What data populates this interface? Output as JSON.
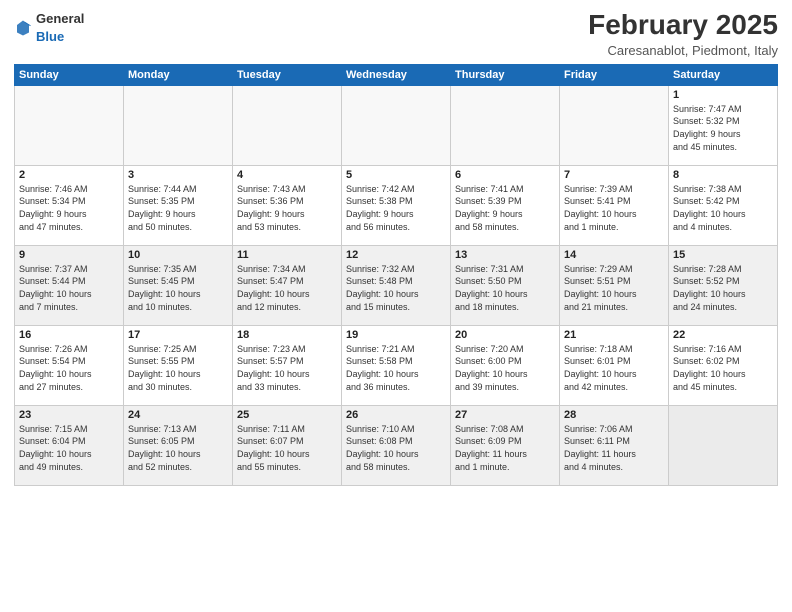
{
  "header": {
    "logo_general": "General",
    "logo_blue": "Blue",
    "month_title": "February 2025",
    "location": "Caresanablot, Piedmont, Italy"
  },
  "days_of_week": [
    "Sunday",
    "Monday",
    "Tuesday",
    "Wednesday",
    "Thursday",
    "Friday",
    "Saturday"
  ],
  "weeks": [
    {
      "shaded": false,
      "days": [
        {
          "num": "",
          "info": ""
        },
        {
          "num": "",
          "info": ""
        },
        {
          "num": "",
          "info": ""
        },
        {
          "num": "",
          "info": ""
        },
        {
          "num": "",
          "info": ""
        },
        {
          "num": "",
          "info": ""
        },
        {
          "num": "1",
          "info": "Sunrise: 7:47 AM\nSunset: 5:32 PM\nDaylight: 9 hours\nand 45 minutes."
        }
      ]
    },
    {
      "shaded": false,
      "days": [
        {
          "num": "2",
          "info": "Sunrise: 7:46 AM\nSunset: 5:34 PM\nDaylight: 9 hours\nand 47 minutes."
        },
        {
          "num": "3",
          "info": "Sunrise: 7:44 AM\nSunset: 5:35 PM\nDaylight: 9 hours\nand 50 minutes."
        },
        {
          "num": "4",
          "info": "Sunrise: 7:43 AM\nSunset: 5:36 PM\nDaylight: 9 hours\nand 53 minutes."
        },
        {
          "num": "5",
          "info": "Sunrise: 7:42 AM\nSunset: 5:38 PM\nDaylight: 9 hours\nand 56 minutes."
        },
        {
          "num": "6",
          "info": "Sunrise: 7:41 AM\nSunset: 5:39 PM\nDaylight: 9 hours\nand 58 minutes."
        },
        {
          "num": "7",
          "info": "Sunrise: 7:39 AM\nSunset: 5:41 PM\nDaylight: 10 hours\nand 1 minute."
        },
        {
          "num": "8",
          "info": "Sunrise: 7:38 AM\nSunset: 5:42 PM\nDaylight: 10 hours\nand 4 minutes."
        }
      ]
    },
    {
      "shaded": true,
      "days": [
        {
          "num": "9",
          "info": "Sunrise: 7:37 AM\nSunset: 5:44 PM\nDaylight: 10 hours\nand 7 minutes."
        },
        {
          "num": "10",
          "info": "Sunrise: 7:35 AM\nSunset: 5:45 PM\nDaylight: 10 hours\nand 10 minutes."
        },
        {
          "num": "11",
          "info": "Sunrise: 7:34 AM\nSunset: 5:47 PM\nDaylight: 10 hours\nand 12 minutes."
        },
        {
          "num": "12",
          "info": "Sunrise: 7:32 AM\nSunset: 5:48 PM\nDaylight: 10 hours\nand 15 minutes."
        },
        {
          "num": "13",
          "info": "Sunrise: 7:31 AM\nSunset: 5:50 PM\nDaylight: 10 hours\nand 18 minutes."
        },
        {
          "num": "14",
          "info": "Sunrise: 7:29 AM\nSunset: 5:51 PM\nDaylight: 10 hours\nand 21 minutes."
        },
        {
          "num": "15",
          "info": "Sunrise: 7:28 AM\nSunset: 5:52 PM\nDaylight: 10 hours\nand 24 minutes."
        }
      ]
    },
    {
      "shaded": false,
      "days": [
        {
          "num": "16",
          "info": "Sunrise: 7:26 AM\nSunset: 5:54 PM\nDaylight: 10 hours\nand 27 minutes."
        },
        {
          "num": "17",
          "info": "Sunrise: 7:25 AM\nSunset: 5:55 PM\nDaylight: 10 hours\nand 30 minutes."
        },
        {
          "num": "18",
          "info": "Sunrise: 7:23 AM\nSunset: 5:57 PM\nDaylight: 10 hours\nand 33 minutes."
        },
        {
          "num": "19",
          "info": "Sunrise: 7:21 AM\nSunset: 5:58 PM\nDaylight: 10 hours\nand 36 minutes."
        },
        {
          "num": "20",
          "info": "Sunrise: 7:20 AM\nSunset: 6:00 PM\nDaylight: 10 hours\nand 39 minutes."
        },
        {
          "num": "21",
          "info": "Sunrise: 7:18 AM\nSunset: 6:01 PM\nDaylight: 10 hours\nand 42 minutes."
        },
        {
          "num": "22",
          "info": "Sunrise: 7:16 AM\nSunset: 6:02 PM\nDaylight: 10 hours\nand 45 minutes."
        }
      ]
    },
    {
      "shaded": true,
      "days": [
        {
          "num": "23",
          "info": "Sunrise: 7:15 AM\nSunset: 6:04 PM\nDaylight: 10 hours\nand 49 minutes."
        },
        {
          "num": "24",
          "info": "Sunrise: 7:13 AM\nSunset: 6:05 PM\nDaylight: 10 hours\nand 52 minutes."
        },
        {
          "num": "25",
          "info": "Sunrise: 7:11 AM\nSunset: 6:07 PM\nDaylight: 10 hours\nand 55 minutes."
        },
        {
          "num": "26",
          "info": "Sunrise: 7:10 AM\nSunset: 6:08 PM\nDaylight: 10 hours\nand 58 minutes."
        },
        {
          "num": "27",
          "info": "Sunrise: 7:08 AM\nSunset: 6:09 PM\nDaylight: 11 hours\nand 1 minute."
        },
        {
          "num": "28",
          "info": "Sunrise: 7:06 AM\nSunset: 6:11 PM\nDaylight: 11 hours\nand 4 minutes."
        },
        {
          "num": "",
          "info": ""
        }
      ]
    }
  ]
}
